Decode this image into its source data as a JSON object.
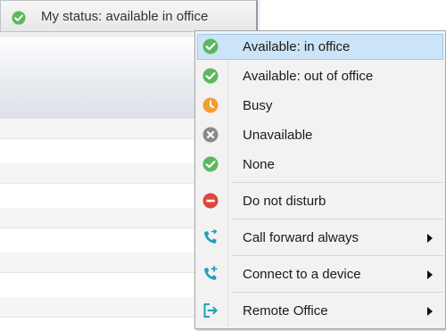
{
  "status_button": {
    "label": "My status: available in office",
    "icon": "green-check-icon"
  },
  "status_menu": {
    "items": [
      {
        "label": "Available: in office",
        "icon": "green-check-icon",
        "selected": true
      },
      {
        "label": "Available: out of office",
        "icon": "green-check-icon"
      },
      {
        "label": "Busy",
        "icon": "orange-clock-icon"
      },
      {
        "label": "Unavailable",
        "icon": "gray-x-icon"
      },
      {
        "label": "None",
        "icon": "green-check-icon"
      },
      {
        "label": "Do not disturb",
        "icon": "red-minus-icon"
      },
      {
        "label": "Call forward always",
        "icon": "phone-forward-icon",
        "submenu": true
      },
      {
        "label": "Connect to a device",
        "icon": "phone-add-icon",
        "submenu": true
      },
      {
        "label": "Remote Office",
        "icon": "remote-office-icon",
        "submenu": true
      }
    ]
  },
  "colors": {
    "selected_bg": "#cce4f7",
    "check_green": "#5cb85c",
    "busy_orange": "#f0a030",
    "unavailable_gray": "#8a8a8a",
    "dnd_red": "#e0443e",
    "teal_icon": "#1fa0b8"
  }
}
